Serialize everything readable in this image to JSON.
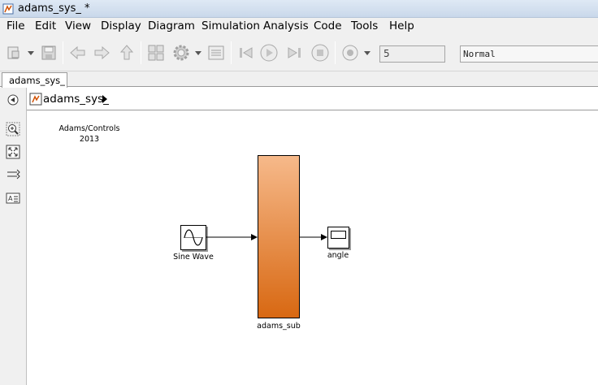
{
  "window": {
    "title": "adams_sys_ *"
  },
  "menu": [
    "File",
    "Edit",
    "View",
    "Display",
    "Diagram",
    "Simulation",
    "Analysis",
    "Code",
    "Tools",
    "Help"
  ],
  "toolbar": {
    "stop_time": "5",
    "simulation_mode": "Normal"
  },
  "tabs": [
    {
      "label": "adams_sys_"
    }
  ],
  "explorer": {
    "path": "adams_sys_"
  },
  "diagram": {
    "annotation_line1": "Adams/Controls",
    "annotation_line2": "2013",
    "blocks": {
      "sine": "Sine Wave",
      "subsystem": "adams_sub",
      "scope": "angle"
    },
    "colors": {
      "subsystem_top": "#f6b98a",
      "subsystem_bottom": "#d86812"
    }
  }
}
